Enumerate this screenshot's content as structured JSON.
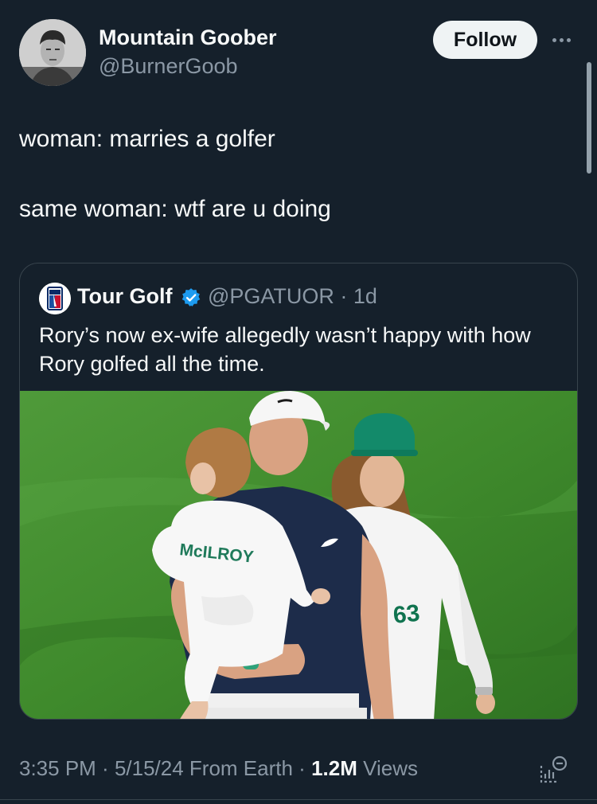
{
  "author": {
    "name": "Mountain Goober",
    "handle": "@BurnerGoob",
    "follow_label": "Follow"
  },
  "tweet": {
    "lines": [
      "woman: marries a golfer",
      "same woman: wtf are u doing"
    ]
  },
  "quote": {
    "name": "Tour Golf",
    "handle_time": "@PGATUOR · 1d",
    "text": "Rory’s now ex-wife allegedly wasn’t happy with how Rory golfed all the time.",
    "photo": {
      "shirt_text": "McILROY",
      "bib_number": "63"
    }
  },
  "footer": {
    "time": "3:35 PM",
    "date": "5/15/24",
    "source": "From Earth",
    "views_count": "1.2M",
    "views_label": "Views"
  },
  "colors": {
    "background": "#15202b",
    "verified": "#1d9bf0",
    "muted_text": "#8b98a5"
  },
  "icons": [
    "more-icon",
    "verified-badge-icon",
    "analytics-icon"
  ]
}
